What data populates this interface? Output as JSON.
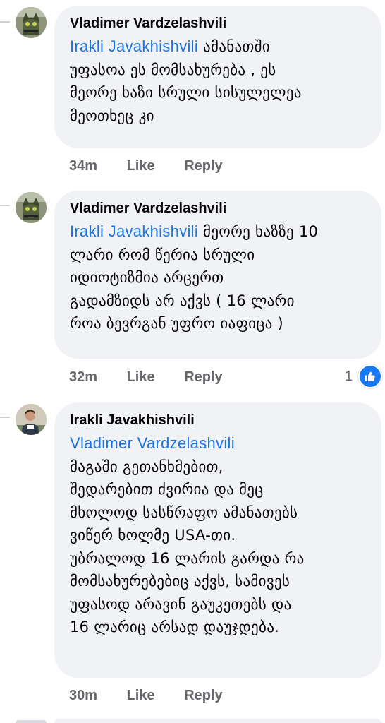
{
  "comments": [
    {
      "author": "Vladimer Vardzelashvili",
      "mention": "Irakli Javakhishvili",
      "lines": [
        "ამანათში",
        "უფასოა ეს მომსახურება  ,  ეს",
        "მეორე ხაზი სრული სისულელეა",
        "მეოთხეც კი"
      ],
      "time": "34m",
      "like_label": "Like",
      "reply_label": "Reply",
      "avatar_icon": "cat-avatar"
    },
    {
      "author": "Vladimer Vardzelashvili",
      "mention": "Irakli Javakhishvili",
      "lines": [
        "მეორე ხაზზე 10",
        "ლარი რომ წერია სრული",
        "იდიოტიზმია არცერთ",
        "გადამზიდს არ აქვს   ( 16 ლარი",
        "როა ბევრგან უფრო იაფიცა )"
      ],
      "time": "32m",
      "like_label": "Like",
      "reply_label": "Reply",
      "reaction_count": "1",
      "reaction_icon": "thumbs-up-icon",
      "avatar_icon": "cat-avatar"
    },
    {
      "author": "Irakli Javakhishvili",
      "mention": "Vladimer Vardzelashvili",
      "lines": [
        "მაგაში გეთანხმებით,",
        "შედარებით ძვირია და მეც",
        "მხოლოდ სასწრაფო ამანათებს",
        "ვიწერ ხოლმე USA-თი.",
        "უბრალოდ 16 ლარის გარდა რა",
        "მომსახურებებიც აქვს, სამივეს",
        "უფასოდ არავინ გაუკეთებს და",
        "16 ლარიც არსად დაუჯდება."
      ],
      "time": "30m",
      "like_label": "Like",
      "reply_label": "Reply",
      "avatar_icon": "person-avatar"
    }
  ],
  "colors": {
    "bubble": "#f0f2f5",
    "mention": "#1b74e4",
    "meta": "#65676b",
    "like_badge": "#1877f2"
  }
}
